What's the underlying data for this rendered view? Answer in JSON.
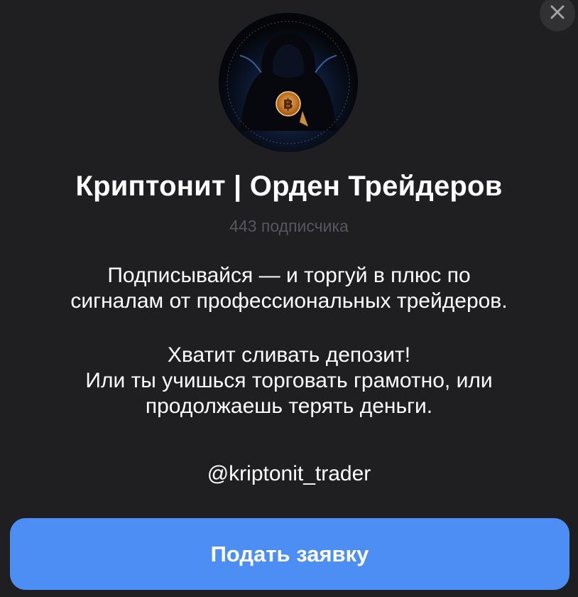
{
  "close": {
    "icon": "close-icon"
  },
  "channel": {
    "avatar_icon": "bitcoin-hooded-figure-avatar",
    "title": "Криптонит | Орден Трейдеров",
    "subscribers": "443 подписчика"
  },
  "description": {
    "line1": "Подписывайся — и торгуй в плюс по",
    "line2": "сигналам от профессиональных трейдеров.",
    "line3": "Хватит сливать депозит!",
    "line4": "Или ты учишься торговать грамотно, или",
    "line5": "продолжаешь терять деньги.",
    "handle": "@kriptonit_trader"
  },
  "cta": {
    "label": "Подать заявку"
  },
  "colors": {
    "background": "#1f1f21",
    "accent": "#4d8ef5",
    "muted_text": "#58585c"
  }
}
